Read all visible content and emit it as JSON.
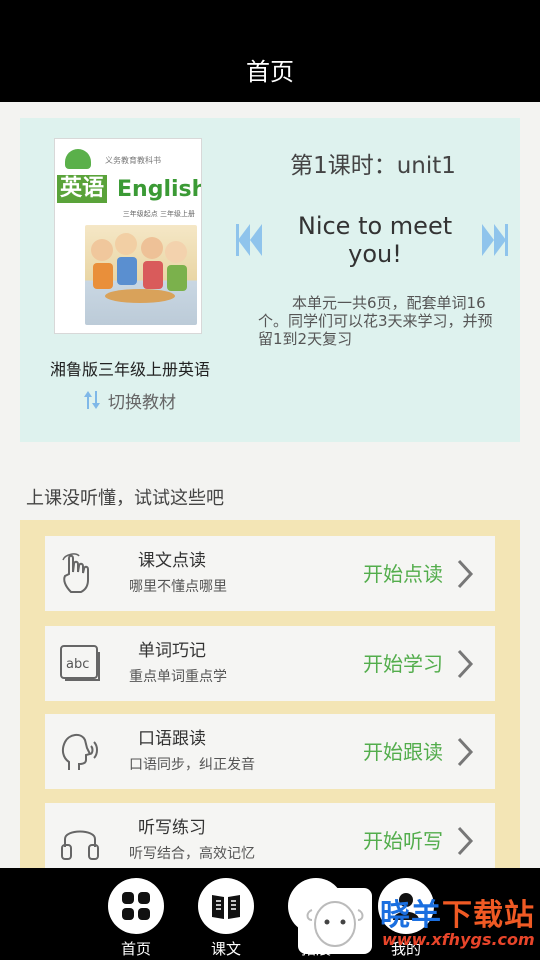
{
  "header": {
    "title": "首页"
  },
  "lesson": {
    "cover": {
      "publisher_line": "义务教育教科书",
      "title_cn": "英语",
      "title_en": "English",
      "grade_line": "三年级起点 三年级上册"
    },
    "book_name": "湘鲁版三年级上册英语",
    "switch_label": "切换教材",
    "unit_title": "第1课时：unit1",
    "unit_name": "Nice to meet you!",
    "unit_description": "本单元一共6页，配套单词16个。同学们可以花3天来学习，并预留1到2天复习",
    "prev_icon": "double-left-arrow-icon",
    "next_icon": "double-right-arrow-icon",
    "accent_color": "#8fc4ec",
    "panel_color": "#def2ee"
  },
  "section": {
    "title": "上课没听懂，试试这些吧"
  },
  "practice_items": [
    {
      "title": "课文点读",
      "subtitle": "哪里不懂点哪里",
      "action": "开始点读",
      "icon": "hand-touch-icon"
    },
    {
      "title": "单词巧记",
      "subtitle": "重点单词重点学",
      "action": "开始学习",
      "icon": "abc-card-icon"
    },
    {
      "title": "口语跟读",
      "subtitle": "口语同步，纠正发音",
      "action": "开始跟读",
      "icon": "speaking-head-icon"
    },
    {
      "title": "听写练习",
      "subtitle": "听写结合，高效记忆",
      "action": "开始听写",
      "icon": "headphones-icon"
    }
  ],
  "action_color": "#53ad4c",
  "tabbar": {
    "tabs": [
      {
        "label": "首页",
        "icon": "grid-icon"
      },
      {
        "label": "课文",
        "icon": "book-icon"
      },
      {
        "label": "拓展",
        "icon": "extend-icon"
      },
      {
        "label": "我的",
        "icon": "user-icon"
      }
    ]
  },
  "watermark": {
    "text_blue": "晓羊",
    "text_orange": "下载站",
    "url": "www.xfhygs.com"
  }
}
